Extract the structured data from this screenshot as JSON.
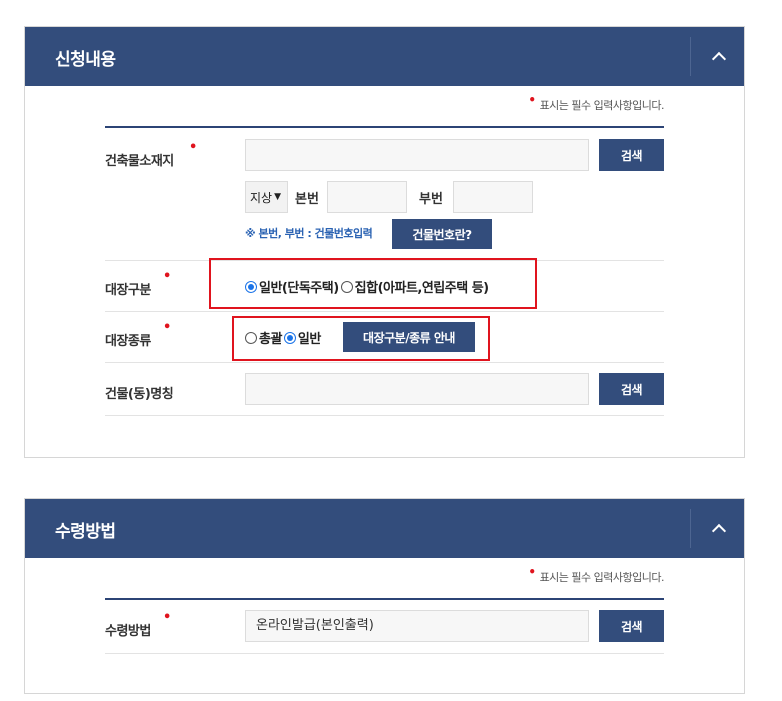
{
  "section1": {
    "title": "신청내용",
    "required_note": "표시는 필수 입력사항입니다.",
    "address": {
      "label": "건축물소재지",
      "value": "",
      "search_btn": "검색",
      "select_value": "지상",
      "bonbeon_label": "본번",
      "bonbeon_value": "",
      "bubeon_label": "부번",
      "bubeon_value": "",
      "hint": "※ 본번, 부번 : 건물번호입력",
      "help_btn": "건물번호란?"
    },
    "ledger_type": {
      "label": "대장구분",
      "options": [
        {
          "label": "일반(단독주택)",
          "checked": true
        },
        {
          "label": "집합(아파트,연립주택 등)",
          "checked": false
        }
      ]
    },
    "ledger_kind": {
      "label": "대장종류",
      "options": [
        {
          "label": "총괄",
          "checked": false
        },
        {
          "label": "일반",
          "checked": true
        }
      ],
      "guide_btn": "대장구분/종류 안내"
    },
    "building_name": {
      "label": "건물(동)명칭",
      "value": "",
      "search_btn": "검색"
    }
  },
  "section2": {
    "title": "수령방법",
    "required_note": "표시는 필수 입력사항입니다.",
    "receive": {
      "label": "수령방법",
      "value": "온라인발급(본인출력)",
      "search_btn": "검색"
    }
  },
  "colors": {
    "header_bg": "#334d7c",
    "button_bg": "#334d7c",
    "required_dot": "#e0141e",
    "highlight_box": "#e0141e",
    "hint_text": "#2b63b3"
  }
}
